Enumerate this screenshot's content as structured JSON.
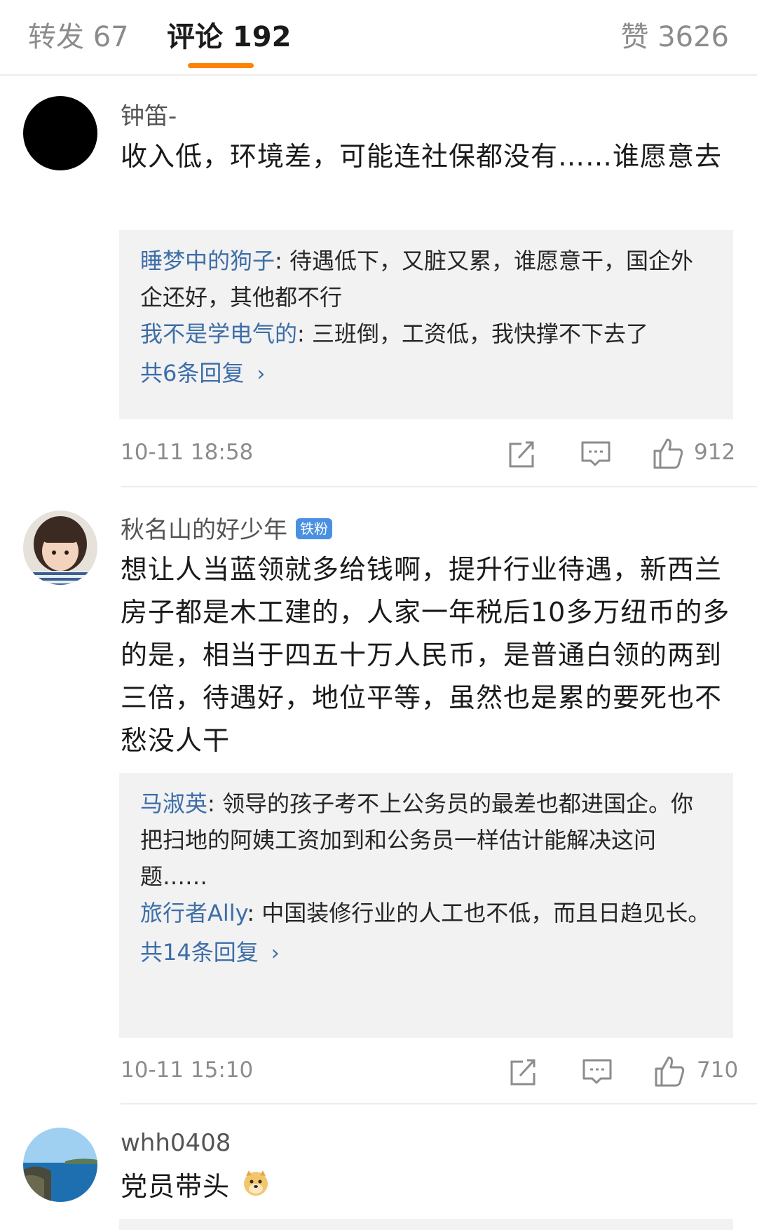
{
  "tabs": {
    "repost": "转发 67",
    "comments": "评论 192",
    "likes": "赞 3626"
  },
  "comments": [
    {
      "username": "钟笛-",
      "content": "收入低，环境差，可能连社保都没有……谁愿意去",
      "replies": [
        {
          "user": "睡梦中的狗子",
          "text": ": 待遇低下，又脏又累，谁愿意干，国企外企还好，其他都不行"
        },
        {
          "user": "我不是学电气的",
          "text": ": 三班倒，工资低，我快撑不下去了"
        }
      ],
      "more_replies": "共6条回复",
      "timestamp": "10-11 18:58",
      "likes": "912"
    },
    {
      "username": "秋名山的好少年",
      "badge": "铁粉",
      "content": "想让人当蓝领就多给钱啊，提升行业待遇，新西兰房子都是木工建的，人家一年税后10多万纽币的多的是，相当于四五十万人民币，是普通白领的两到三倍，待遇好，地位平等，虽然也是累的要死也不愁没人干",
      "replies": [
        {
          "user": "马淑英",
          "text": ": 领导的孩子考不上公务员的最差也都进国企。你把扫地的阿姨工资加到和公务员一样估计能解决这问题……"
        },
        {
          "user": "旅行者Ally",
          "text": ": 中国装修行业的人工也不低，而且日趋见长。"
        }
      ],
      "more_replies": "共14条回复",
      "timestamp": "10-11 15:10",
      "likes": "710"
    },
    {
      "username": "whh0408",
      "content": "党员带头"
    }
  ],
  "icons": {
    "share": "share-icon",
    "comment": "comment-icon",
    "like": "thumbs-up-icon",
    "emoji": "doge-emoji-icon"
  },
  "colors": {
    "accent": "#ff8200",
    "link": "#3d6ea8",
    "badge": "#4a90e2"
  }
}
